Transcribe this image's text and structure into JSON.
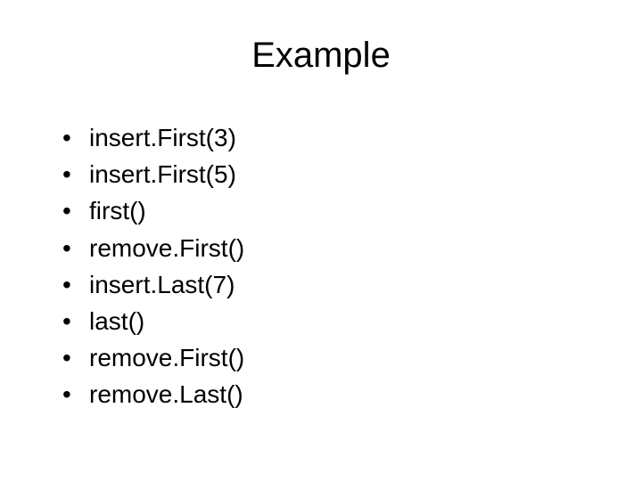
{
  "title": "Example",
  "bullets": {
    "b0": "insert.First(3)",
    "b1": "insert.First(5)",
    "b2": "first()",
    "b3": "remove.First()",
    "b4": "insert.Last(7)",
    "b5": "last()",
    "b6": "remove.First()",
    "b7": "remove.Last()"
  },
  "marker": "•"
}
